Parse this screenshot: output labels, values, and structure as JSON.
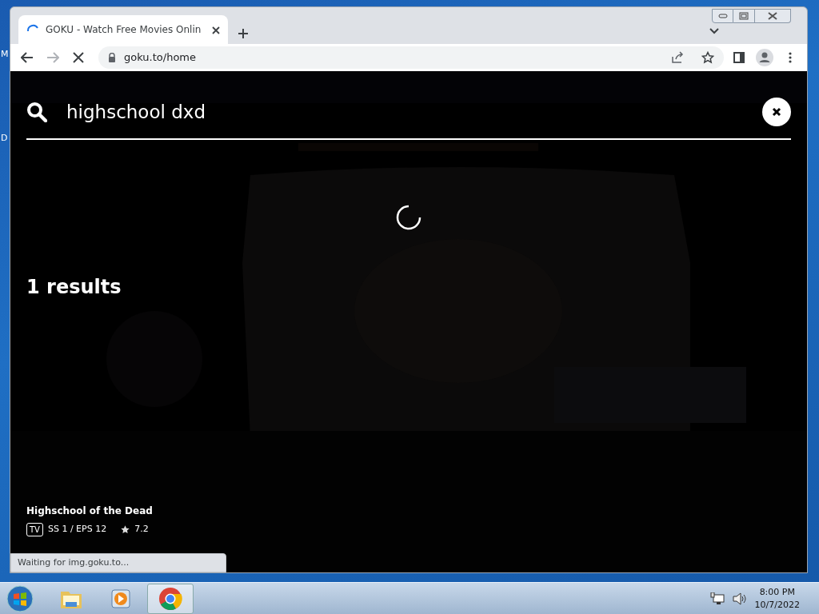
{
  "desktop": {
    "icon_labels": [
      "M",
      "D"
    ]
  },
  "browser": {
    "tab": {
      "title": "GOKU - Watch Free Movies Onlin",
      "loading": true
    },
    "address": "goku.to/home",
    "loading": true
  },
  "search": {
    "query": "highschool dxd"
  },
  "results": {
    "heading": "1 results",
    "items": [
      {
        "title": "Highschool of the Dead",
        "type": "TV",
        "episodes": "SS 1 / EPS 12",
        "rating": "7.2"
      }
    ]
  },
  "status_bubble": "Waiting for img.goku.to...",
  "taskbar": {
    "apps": [
      {
        "kind": "folder",
        "selected": false
      },
      {
        "kind": "media",
        "selected": false
      },
      {
        "kind": "chrome",
        "selected": true
      }
    ],
    "clock": {
      "time": "8:00 PM",
      "date": "10/7/2022"
    }
  }
}
